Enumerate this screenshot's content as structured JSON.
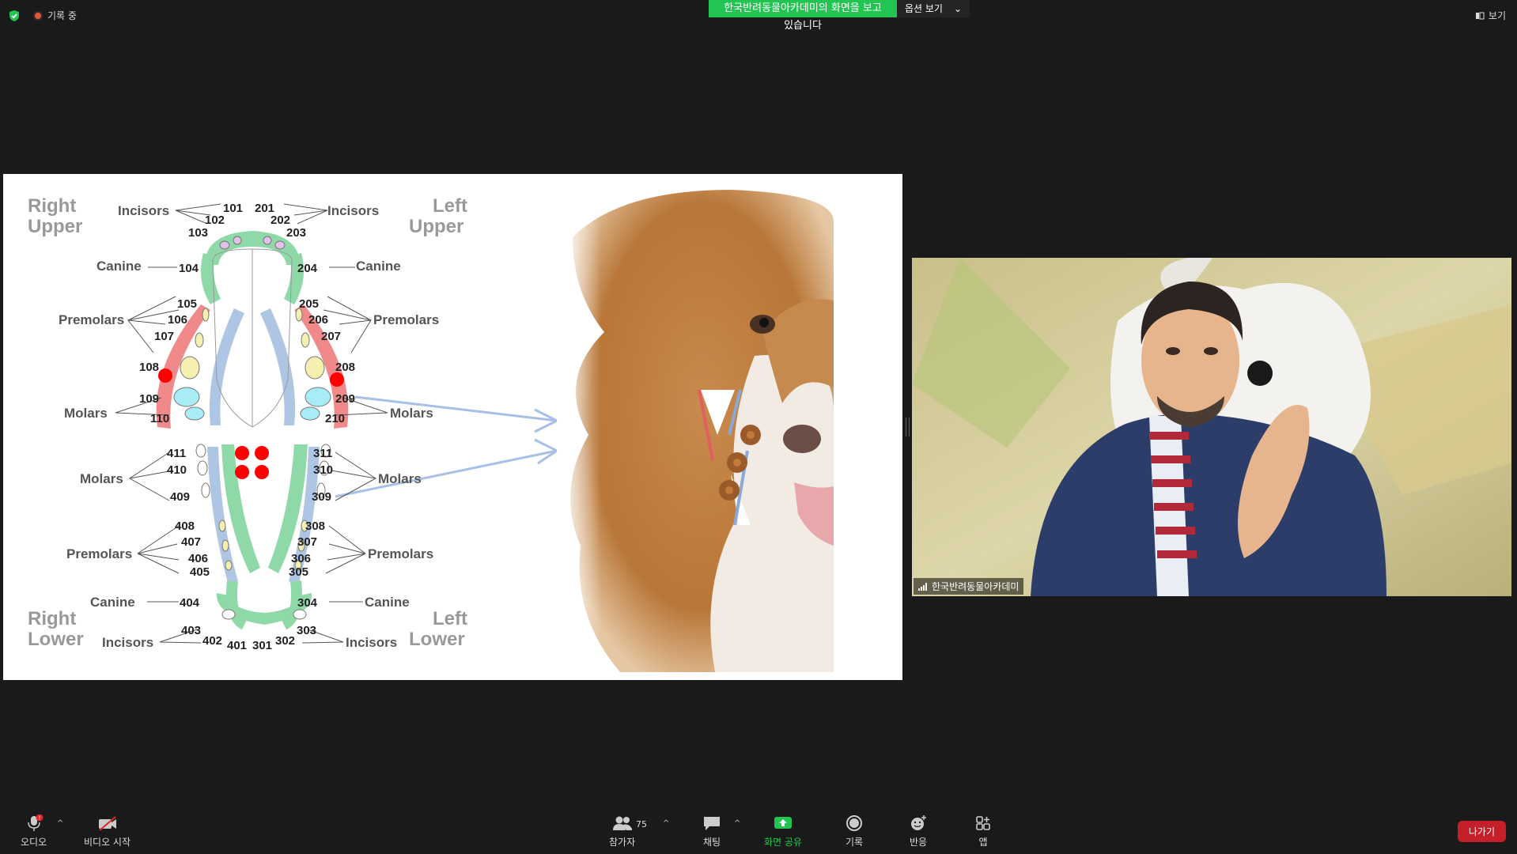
{
  "topbar": {
    "recording_label": "기록 중",
    "share_banner": "한국반려동물아카데미의 화면을 보고 있습니다",
    "view_options": "옵션 보기",
    "view_label": "보기"
  },
  "slide": {
    "corner_labels": {
      "right_upper_1": "Right",
      "right_upper_2": "Upper",
      "left_upper_1": "Left",
      "left_upper_2": "Upper",
      "right_lower_1": "Right",
      "right_lower_2": "Lower",
      "left_lower_1": "Left",
      "left_lower_2": "Lower"
    },
    "tooth_groups": {
      "incisors": "Incisors",
      "canine": "Canine",
      "premolars": "Premolars",
      "molars": "Molars"
    },
    "tooth_numbers": {
      "t101": "101",
      "t102": "102",
      "t103": "103",
      "t104": "104",
      "t105": "105",
      "t106": "106",
      "t107": "107",
      "t108": "108",
      "t109": "109",
      "t110": "110",
      "t201": "201",
      "t202": "202",
      "t203": "203",
      "t204": "204",
      "t205": "205",
      "t206": "206",
      "t207": "207",
      "t208": "208",
      "t209": "209",
      "t210": "210",
      "t301": "301",
      "t302": "302",
      "t303": "303",
      "t304": "304",
      "t305": "305",
      "t306": "306",
      "t307": "307",
      "t308": "308",
      "t309": "309",
      "t310": "310",
      "t311": "311",
      "t401": "401",
      "t402": "402",
      "t403": "403",
      "t404": "404",
      "t405": "405",
      "t406": "406",
      "t407": "407",
      "t408": "408",
      "t409": "409",
      "t410": "410",
      "t411": "411"
    }
  },
  "camera": {
    "name": "한국반려동물아카데미"
  },
  "toolbar": {
    "audio": "오디오",
    "video": "비디오 시작",
    "participants": "참가자",
    "participants_count": "75",
    "chat": "채팅",
    "share": "화면 공유",
    "record": "기록",
    "reactions": "반응",
    "apps": "앱",
    "leave": "나가기"
  },
  "colors": {
    "share_green": "#23c552",
    "leave_red": "#c51f2a",
    "gum_green": "#7ed3a0",
    "red_band": "#f08080",
    "blue_band": "#a9c3e3"
  }
}
